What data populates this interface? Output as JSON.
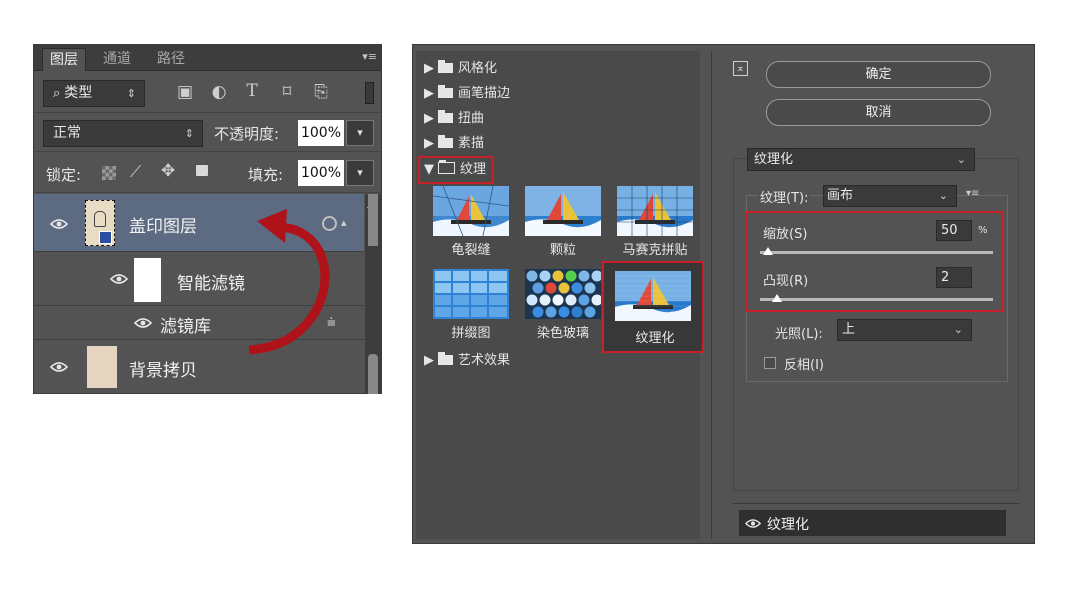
{
  "layers_panel": {
    "tabs": [
      "图层",
      "通道",
      "路径"
    ],
    "filter_kind": "类型",
    "blend_mode": "正常",
    "opacity_label": "不透明度:",
    "opacity_value": "100%",
    "lock_label": "锁定:",
    "fill_label": "填充:",
    "fill_value": "100%",
    "layers": [
      {
        "name": "盖印图层"
      },
      {
        "name": "智能滤镜"
      },
      {
        "name": "滤镜库"
      },
      {
        "name": "背景拷贝"
      }
    ]
  },
  "filter_gallery": {
    "folders": {
      "f1": "风格化",
      "f2": "画笔描边",
      "f3": "扭曲",
      "f4": "素描",
      "f5": "纹理",
      "f6": "艺术效果"
    },
    "thumbnails": [
      "龟裂缝",
      "颗粒",
      "马赛克拼贴",
      "拼缀图",
      "染色玻璃",
      "纹理化"
    ],
    "ok_button": "确定",
    "cancel_button": "取消",
    "filter_select": "纹理化",
    "texture_label": "纹理(T):",
    "texture_value": "画布",
    "scaling_label": "缩放(S)",
    "scaling_value": "50",
    "scaling_unit": "%",
    "scaling_level": 0.0,
    "relief_label": "凸现(R)",
    "relief_value": "2",
    "relief_level": 0.04,
    "light_label": "光照(L):",
    "light_value": "上",
    "invert_label": "反相(I)",
    "applied_filter": "纹理化"
  },
  "colors": {
    "panel_bg": "#535353",
    "highlight": "#c8202a",
    "selected_layer": "#5c6b82"
  }
}
